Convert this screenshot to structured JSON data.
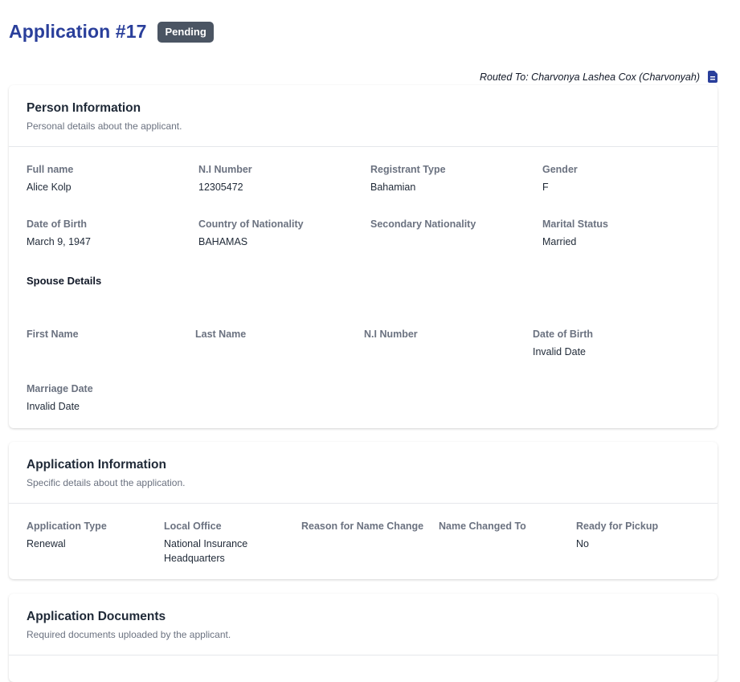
{
  "header": {
    "title": "Application #17",
    "status": "Pending"
  },
  "routed": {
    "text": "Routed To: Charvonya Lashea Cox (Charvonyah)",
    "icon": "document-icon",
    "icon_color": "#2a3f9b"
  },
  "person": {
    "title": "Person Information",
    "subtitle": "Personal details about the applicant.",
    "fields": [
      {
        "label": "Full name",
        "value": "Alice Kolp"
      },
      {
        "label": "N.I Number",
        "value": "12305472"
      },
      {
        "label": "Registrant Type",
        "value": "Bahamian"
      },
      {
        "label": "Gender",
        "value": "F"
      },
      {
        "label": "Date of Birth",
        "value": "March 9, 1947"
      },
      {
        "label": "Country of Nationality",
        "value": "BAHAMAS"
      },
      {
        "label": "Secondary Nationality",
        "value": ""
      },
      {
        "label": "Marital Status",
        "value": "Married"
      }
    ],
    "spouse": {
      "title": "Spouse Details",
      "fields": [
        {
          "label": "First Name",
          "value": ""
        },
        {
          "label": "Last Name",
          "value": ""
        },
        {
          "label": "N.I Number",
          "value": ""
        },
        {
          "label": "Date of Birth",
          "value": "Invalid Date"
        },
        {
          "label": "Marriage Date",
          "value": "Invalid Date"
        }
      ]
    }
  },
  "application": {
    "title": "Application Information",
    "subtitle": "Specific details about the application.",
    "fields": [
      {
        "label": "Application Type",
        "value": "Renewal"
      },
      {
        "label": "Local Office",
        "value": "National Insurance Headquarters"
      },
      {
        "label": "Reason for Name Change",
        "value": ""
      },
      {
        "label": "Name Changed To",
        "value": ""
      },
      {
        "label": "Ready for Pickup",
        "value": "No"
      }
    ]
  },
  "documents": {
    "title": "Application Documents",
    "subtitle": "Required documents uploaded by the applicant."
  }
}
